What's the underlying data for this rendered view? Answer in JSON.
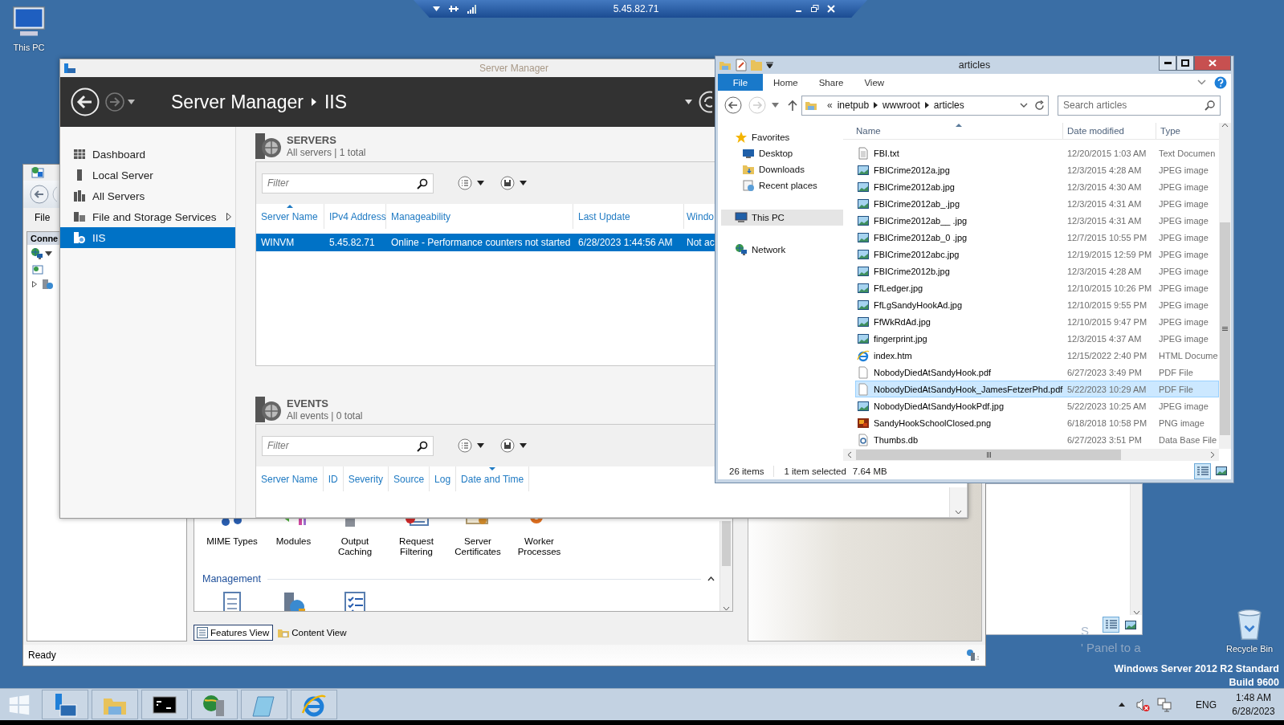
{
  "remote_bar": {
    "address": "5.45.82.71"
  },
  "desktop_icons": [
    {
      "kind": "pc",
      "label": "This PC"
    },
    {
      "kind": "bin",
      "label": "Recycle Bin"
    }
  ],
  "iis_manager": {
    "menu": [
      "File"
    ],
    "connections_title": "Conne",
    "features": [
      {
        "kind": "mime",
        "label": "MIME Types"
      },
      {
        "kind": "modules",
        "label": "Modules"
      },
      {
        "kind": "caching",
        "label": "Output Caching"
      },
      {
        "kind": "request",
        "label": "Request Filtering"
      },
      {
        "kind": "certs",
        "label": "Server Certificates"
      },
      {
        "kind": "worker",
        "label": "Worker Processes"
      }
    ],
    "group": {
      "title": "Management",
      "expanded": true,
      "items": [
        {
          "kind": "doc"
        },
        {
          "kind": "server-globe"
        },
        {
          "kind": "checklist"
        }
      ]
    },
    "view_tabs": [
      {
        "label": "Features View",
        "selected": true
      },
      {
        "label": "Content View",
        "selected": false
      }
    ],
    "status": "Ready"
  },
  "server_manager": {
    "title": "Server Manager",
    "breadcrumb": [
      "Server Manager",
      "IIS"
    ],
    "nav": [
      {
        "kind": "dashboard",
        "label": "Dashboard",
        "selected": false,
        "submenu": false
      },
      {
        "kind": "local",
        "label": "Local Server",
        "selected": false,
        "submenu": false
      },
      {
        "kind": "all",
        "label": "All Servers",
        "selected": false,
        "submenu": false
      },
      {
        "kind": "storage",
        "label": "File and Storage Services",
        "selected": false,
        "submenu": true
      },
      {
        "kind": "iis",
        "label": "IIS",
        "selected": true,
        "submenu": false
      }
    ],
    "servers": {
      "title": "SERVERS",
      "subtitle": "All servers | 1 total",
      "filter_placeholder": "Filter",
      "columns": [
        {
          "label": "Server Name",
          "sorted": true,
          "descending": false
        },
        {
          "label": "IPv4 Address",
          "sorted": false
        },
        {
          "label": "Manageability",
          "sorted": false
        },
        {
          "label": "Last Update",
          "sorted": false
        },
        {
          "label": "Windo",
          "sorted": false
        }
      ],
      "rows": [
        {
          "cells": [
            "WINVM",
            "5.45.82.71",
            "Online - Performance counters not started",
            "6/28/2023 1:44:56 AM",
            "Not ac"
          ],
          "selected": true
        }
      ]
    },
    "events": {
      "title": "EVENTS",
      "subtitle": "All events | 0 total",
      "filter_placeholder": "Filter",
      "columns": [
        {
          "label": "Server Name",
          "sorted": false
        },
        {
          "label": "ID",
          "sorted": false
        },
        {
          "label": "Severity",
          "sorted": false
        },
        {
          "label": "Source",
          "sorted": false
        },
        {
          "label": "Log",
          "sorted": false
        },
        {
          "label": "Date and Time",
          "sorted": true,
          "descending": true
        }
      ]
    }
  },
  "explorer": {
    "title": "articles",
    "ribbon_tabs": [
      {
        "label": "File",
        "selected": true
      },
      {
        "label": "Home",
        "selected": false
      },
      {
        "label": "Share",
        "selected": false
      },
      {
        "label": "View",
        "selected": false
      }
    ],
    "address": {
      "overflow": "«",
      "parts": [
        "inetpub",
        "wwwroot",
        "articles"
      ]
    },
    "search_placeholder": "Search articles",
    "nav": [
      {
        "kind": "star",
        "label": "Favorites",
        "selected": false,
        "children": [
          {
            "kind": "desktop",
            "label": "Desktop",
            "selected": false
          },
          {
            "kind": "downloads",
            "label": "Downloads",
            "selected": false
          },
          {
            "kind": "recent",
            "label": "Recent places",
            "selected": false
          }
        ]
      },
      {
        "kind": "pc",
        "label": "This PC",
        "selected": true
      },
      {
        "kind": "network",
        "label": "Network",
        "selected": false
      }
    ],
    "columns": [
      {
        "label": "Name",
        "sorted": true,
        "descending": false
      },
      {
        "label": "Date modified",
        "sorted": false
      },
      {
        "label": "Type",
        "sorted": false
      }
    ],
    "files": [
      {
        "kind": "text",
        "name": "FBI.txt",
        "date": "12/20/2015 1:03 AM",
        "type": "Text Documen",
        "selected": false
      },
      {
        "kind": "image",
        "name": "FBICrime2012a.jpg",
        "date": "12/3/2015 4:28 AM",
        "type": "JPEG image",
        "selected": false
      },
      {
        "kind": "image",
        "name": "FBICrime2012ab.jpg",
        "date": "12/3/2015 4:30 AM",
        "type": "JPEG image",
        "selected": false
      },
      {
        "kind": "image",
        "name": "FBICrime2012ab_.jpg",
        "date": "12/3/2015 4:31 AM",
        "type": "JPEG image",
        "selected": false
      },
      {
        "kind": "image",
        "name": "FBICrime2012ab__ .jpg",
        "date": "12/3/2015 4:31 AM",
        "type": "JPEG image",
        "selected": false
      },
      {
        "kind": "image",
        "name": "FBICrime2012ab_0 .jpg",
        "date": "12/7/2015 10:55 PM",
        "type": "JPEG image",
        "selected": false
      },
      {
        "kind": "image",
        "name": "FBICrime2012abc.jpg",
        "date": "12/19/2015 12:59 PM",
        "type": "JPEG image",
        "selected": false
      },
      {
        "kind": "image",
        "name": "FBICrime2012b.jpg",
        "date": "12/3/2015 4:28 AM",
        "type": "JPEG image",
        "selected": false
      },
      {
        "kind": "image",
        "name": "FfLedger.jpg",
        "date": "12/10/2015 10:26 PM",
        "type": "JPEG image",
        "selected": false
      },
      {
        "kind": "image",
        "name": "FfLgSandyHookAd.jpg",
        "date": "12/10/2015 9:55 PM",
        "type": "JPEG image",
        "selected": false
      },
      {
        "kind": "image",
        "name": "FfWkRdAd.jpg",
        "date": "12/10/2015 9:47 PM",
        "type": "JPEG image",
        "selected": false
      },
      {
        "kind": "image",
        "name": "fingerprint.jpg",
        "date": "12/3/2015 4:37 AM",
        "type": "JPEG image",
        "selected": false
      },
      {
        "kind": "html",
        "name": "index.htm",
        "date": "12/15/2022 2:40 PM",
        "type": "HTML Docume",
        "selected": false
      },
      {
        "kind": "pdf",
        "name": "NobodyDiedAtSandyHook.pdf",
        "date": "6/27/2023 3:49 PM",
        "type": "PDF File",
        "selected": false
      },
      {
        "kind": "pdf",
        "name": "NobodyDiedAtSandyHook_JamesFetzerPhd.pdf",
        "date": "5/22/2023 10:29 AM",
        "type": "PDF File",
        "selected": true
      },
      {
        "kind": "image",
        "name": "NobodyDiedAtSandyHookPdf.jpg",
        "date": "5/22/2023 10:25 AM",
        "type": "JPEG image",
        "selected": false
      },
      {
        "kind": "png",
        "name": "SandyHookSchoolClosed.png",
        "date": "6/18/2018 10:58 PM",
        "type": "PNG image",
        "selected": false
      },
      {
        "kind": "db",
        "name": "Thumbs.db",
        "date": "6/27/2023 3:51 PM",
        "type": "Data Base File",
        "selected": false
      }
    ],
    "status": {
      "count": "26 items",
      "selection": "1 item selected",
      "size": "7.64 MB"
    },
    "view_buttons": [
      {
        "kind": "details",
        "selected": true
      },
      {
        "kind": "thumbnails",
        "selected": false
      }
    ]
  },
  "behind_window": {
    "view_buttons": [
      {
        "kind": "details",
        "selected": true
      },
      {
        "kind": "thumbnails",
        "selected": false
      }
    ]
  },
  "desktop_overlay": [
    "S",
    "' Panel to a"
  ],
  "os_info": [
    "Windows Server 2012 R2 Standard",
    "Build 9600"
  ],
  "taskbar": {
    "buttons": [
      {
        "kind": "start"
      },
      {
        "kind": "server-manager"
      },
      {
        "kind": "explorer"
      },
      {
        "kind": "cmd"
      },
      {
        "kind": "iis"
      },
      {
        "kind": "notepad"
      },
      {
        "kind": "ie"
      }
    ],
    "tray": {
      "muted": true,
      "language": "ENG",
      "time": "1:48 AM",
      "date": "6/28/2023"
    }
  }
}
